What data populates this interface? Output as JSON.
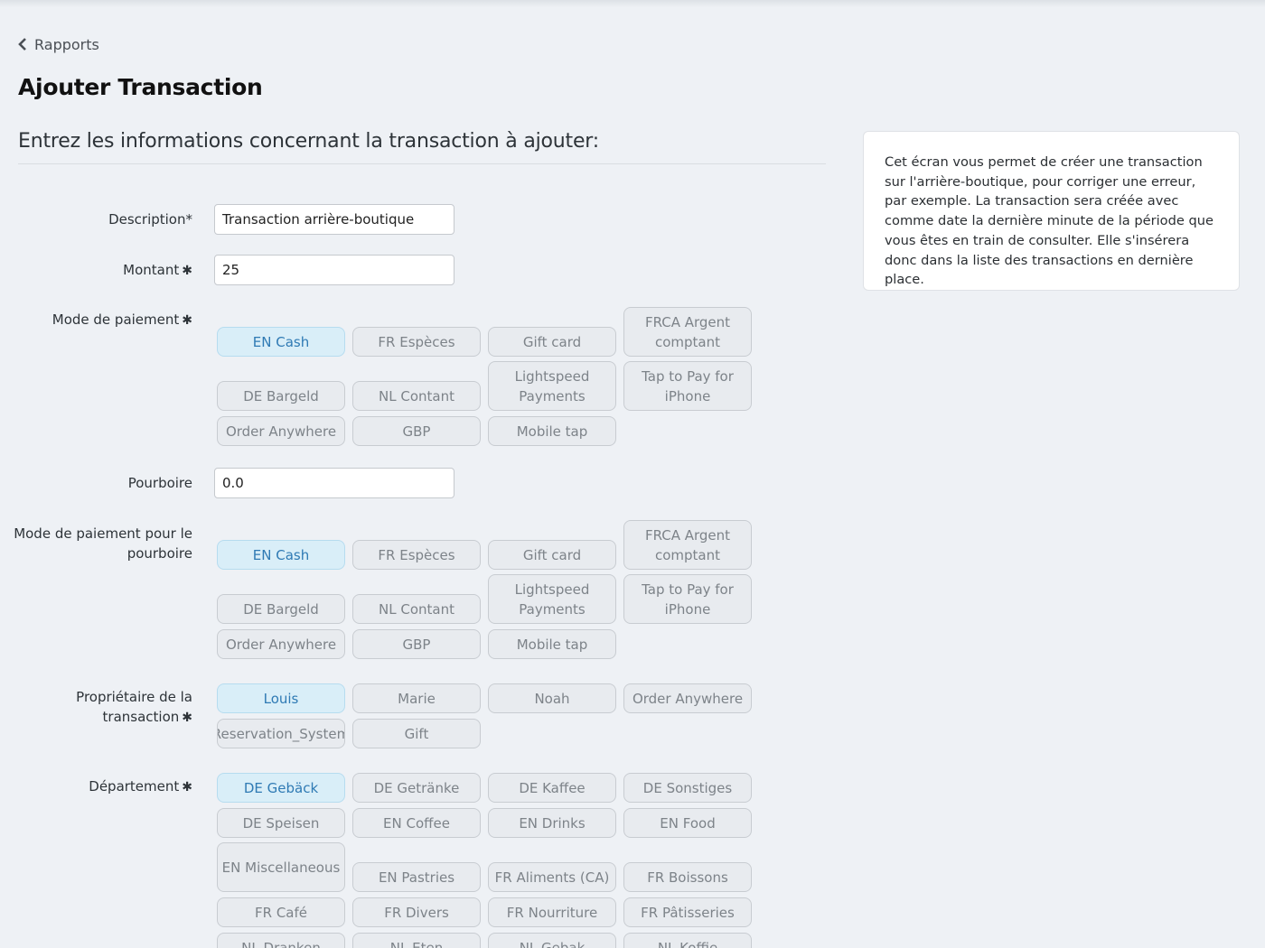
{
  "nav": {
    "back_label": "Rapports"
  },
  "page": {
    "title": "Ajouter Transaction",
    "subtitle": "Entrez les informations concernant la transaction à ajouter:"
  },
  "form": {
    "description": {
      "label": "Description*",
      "value": "Transaction arrière-boutique"
    },
    "montant": {
      "label": "Montant",
      "value": "25"
    },
    "mode_paiement": {
      "label": "Mode de paiement",
      "selected": "EN Cash",
      "options": [
        "EN Cash",
        "FR Espèces",
        "Gift card",
        "FRCA Argent comptant",
        "DE Bargeld",
        "NL Contant",
        "Lightspeed Payments",
        "Tap to Pay for iPhone",
        "Order Anywhere",
        "GBP",
        "Mobile tap"
      ]
    },
    "pourboire": {
      "label": "Pourboire",
      "value": "0.0"
    },
    "mode_paiement_pourboire": {
      "label": "Mode de paiement pour le pourboire",
      "selected": "EN Cash",
      "options": [
        "EN Cash",
        "FR Espèces",
        "Gift card",
        "FRCA Argent comptant",
        "DE Bargeld",
        "NL Contant",
        "Lightspeed Payments",
        "Tap to Pay for iPhone",
        "Order Anywhere",
        "GBP",
        "Mobile tap"
      ]
    },
    "proprietaire": {
      "label": "Propriétaire de la transaction",
      "selected": "Louis",
      "options": [
        "Louis",
        "Marie",
        "Noah",
        "Order Anywhere",
        "Reservation_System",
        "Gift"
      ]
    },
    "departement": {
      "label": "Département",
      "selected": "DE Gebäck",
      "options": [
        "DE Gebäck",
        "DE Getränke",
        "DE Kaffee",
        "DE Sonstiges",
        "DE Speisen",
        "EN Coffee",
        "EN Drinks",
        "EN Food",
        "EN Miscellaneous",
        "EN Pastries",
        "FR Aliments (CA)",
        "FR Boissons",
        "FR Café",
        "FR Divers",
        "FR Nourriture",
        "FR Pâtisseries",
        "NL Dranken",
        "NL Eten",
        "NL Gebak",
        "NL Koffie"
      ]
    },
    "required_mark": "✱"
  },
  "help": {
    "text": "Cet écran vous permet de créer une transaction sur l'arrière-boutique, pour corriger une erreur, par exemple. La transaction sera créée avec comme date la dernière minute de la période que vous êtes en train de consulter. Elle s'insérera donc dans la liste des transactions en dernière place."
  },
  "colors": {
    "background": "#eef1f5",
    "chip_selected_bg": "#d9eef8",
    "chip_selected_text": "#2f7ab4",
    "chip_bg": "#e8ebef",
    "chip_text": "#7d8389"
  }
}
